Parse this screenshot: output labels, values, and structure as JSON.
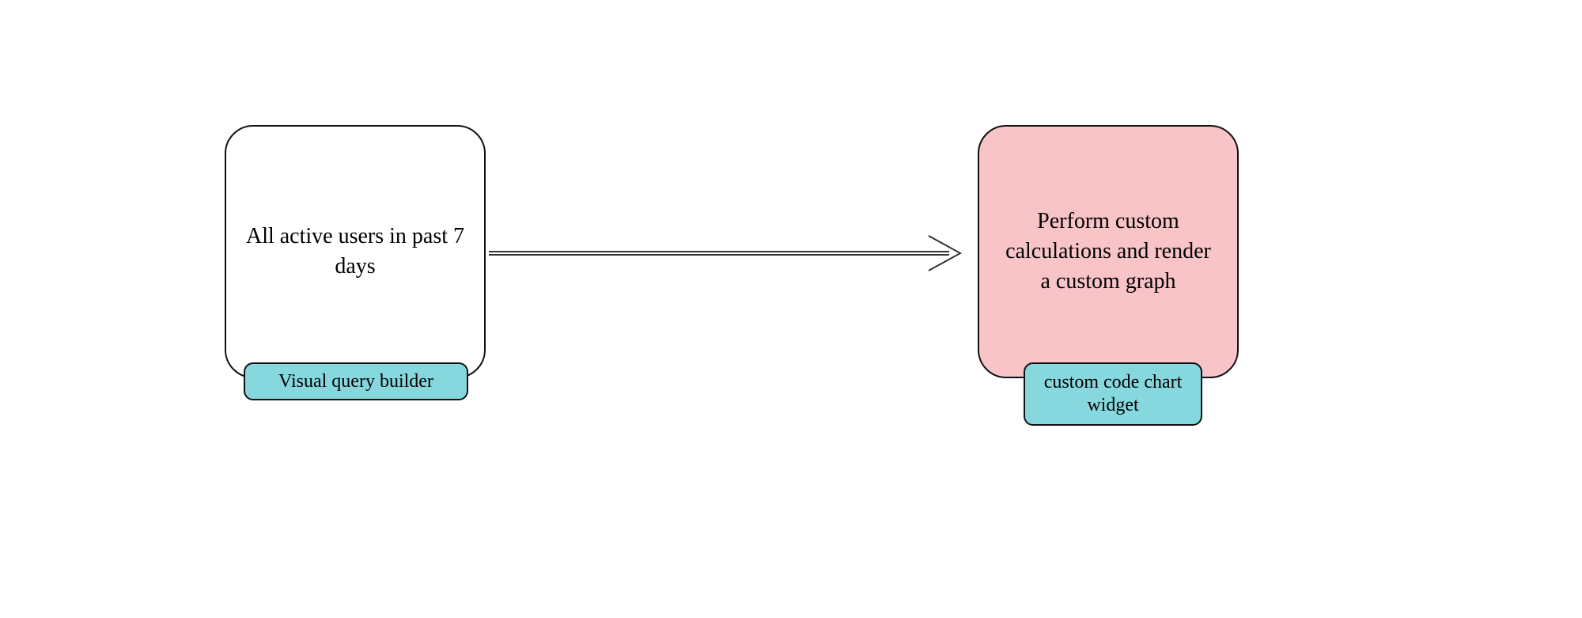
{
  "nodes": {
    "left": {
      "text": "All active users in past 7 days",
      "tag": "Visual query builder"
    },
    "right": {
      "text": "Perform custom calculations and render a custom graph",
      "tag": "custom code chart widget"
    }
  }
}
